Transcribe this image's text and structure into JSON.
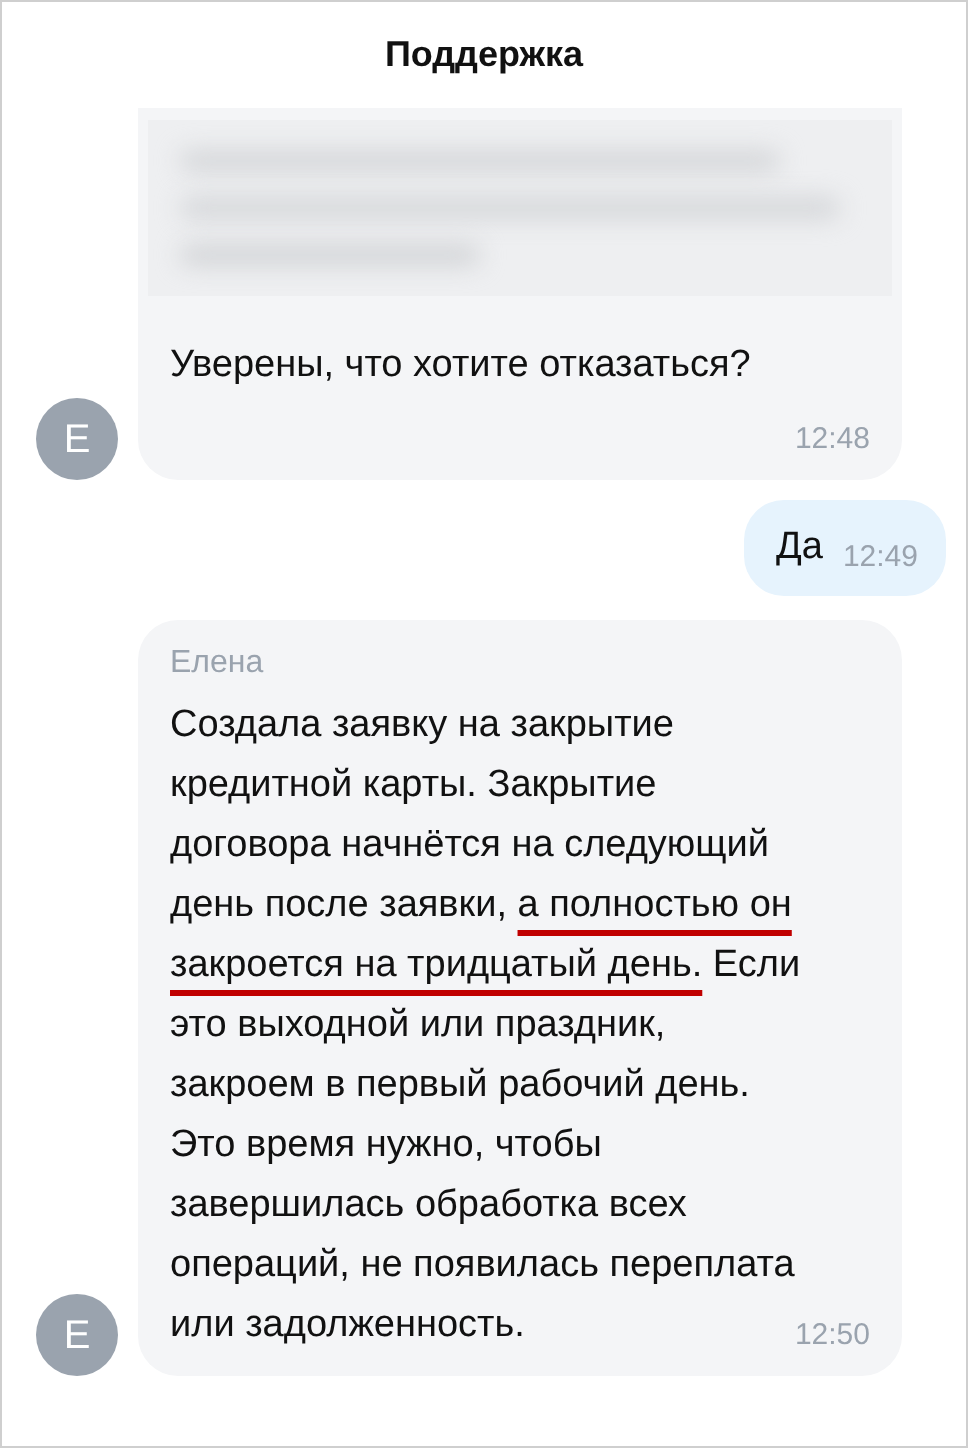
{
  "header": {
    "title": "Поддержка"
  },
  "messages": [
    {
      "kind": "incoming",
      "avatar": "Е",
      "blurred": true,
      "text": "Уверены, что хотите отказаться?",
      "time": "12:48"
    },
    {
      "kind": "outgoing",
      "text": "Да",
      "time": "12:49"
    },
    {
      "kind": "incoming",
      "avatar": "Е",
      "sender": "Елена",
      "segments": [
        {
          "text": "Создала заявку на закрытие\nкредитной карты. Закрытие\nдоговора начнётся на следующий\nдень после заявки, ",
          "underlined": false
        },
        {
          "text": "а полностью он\nзакроется на тридцатый день.",
          "underlined": true
        },
        {
          "text": " Если\nэто выходной или праздник,\nзакроем в первый рабочий день.\nЭто время нужно, чтобы\nзавершилась обработка всех\nопераций, не появилась переплата\nили задолженность.",
          "underlined": false
        }
      ],
      "time": "12:50"
    }
  ]
}
